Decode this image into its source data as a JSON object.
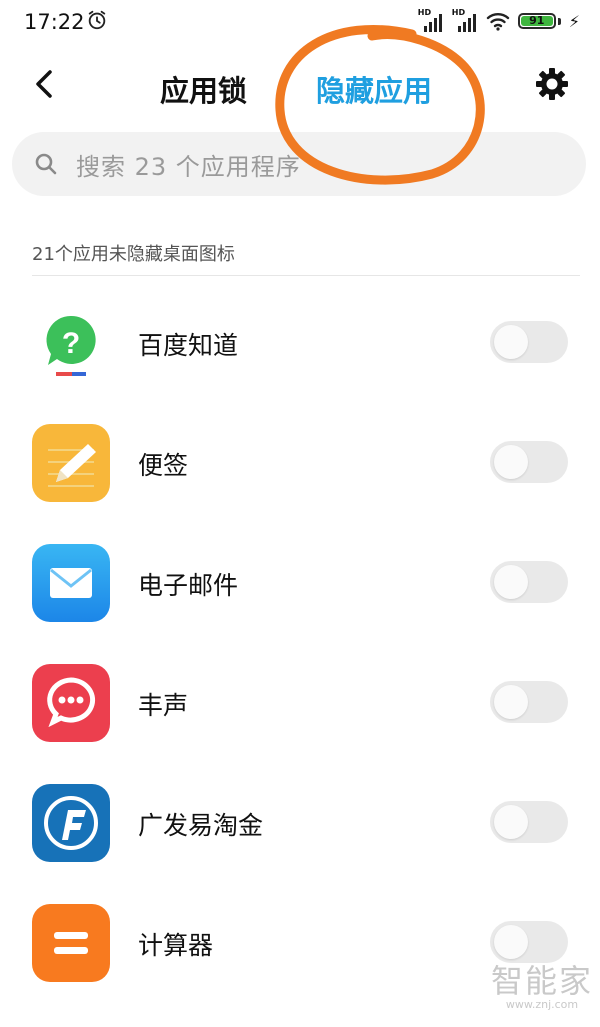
{
  "status_bar": {
    "time": "17:22",
    "signal_label_1": "HD",
    "signal_label_2": "HD",
    "battery_level": "91"
  },
  "header": {
    "tab_applock": "应用锁",
    "tab_hidden_apps": "隐藏应用",
    "active_color": "#1f9fe0",
    "annotation_color": "#f07a22"
  },
  "search": {
    "placeholder": "搜索 23 个应用程序"
  },
  "section": {
    "label": "21个应用未隐藏桌面图标"
  },
  "apps": [
    {
      "name": "百度知道",
      "icon": "baidu-zhidao-icon",
      "hidden": false
    },
    {
      "name": "便签",
      "icon": "notes-icon",
      "hidden": false
    },
    {
      "name": "电子邮件",
      "icon": "email-icon",
      "hidden": false
    },
    {
      "name": "丰声",
      "icon": "fengsheng-icon",
      "hidden": false
    },
    {
      "name": "广发易淘金",
      "icon": "gf-yitaojin-icon",
      "hidden": false
    },
    {
      "name": "计算器",
      "icon": "calculator-icon",
      "hidden": false
    }
  ],
  "watermark": {
    "text": "智能家",
    "url": "www.znj.com"
  }
}
